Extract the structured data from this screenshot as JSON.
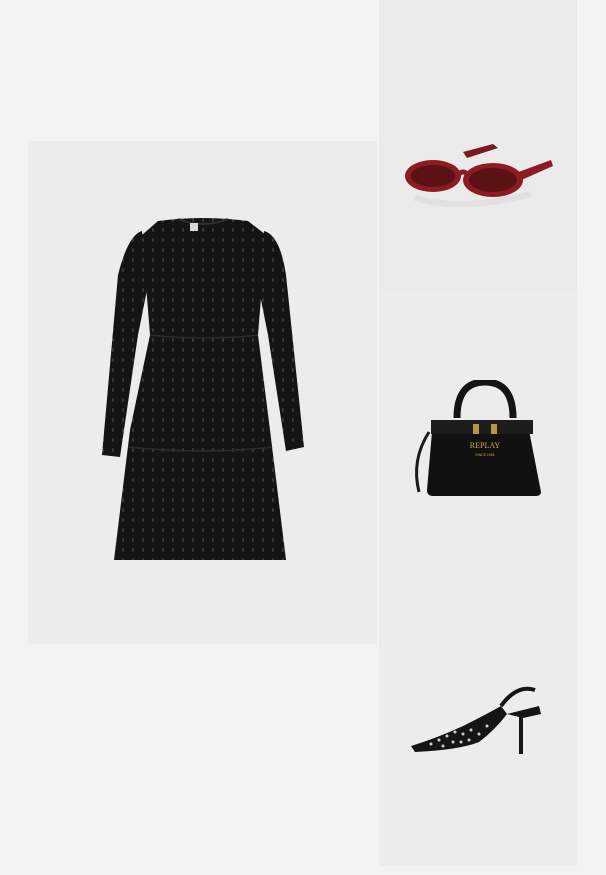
{
  "outfit": {
    "items": [
      {
        "id": "dress",
        "icon": "dress-product-image",
        "color": "#141414"
      },
      {
        "id": "sunglasses",
        "icon": "sunglasses-product-image",
        "color": "#8c1c22"
      },
      {
        "id": "handbag",
        "icon": "handbag-product-image",
        "color": "#111111"
      },
      {
        "id": "heels",
        "icon": "slingback-heel-product-image",
        "color": "#151515"
      }
    ],
    "bag_logo": {
      "brand": "REPLAY",
      "tagline": "SINCE 1981"
    }
  }
}
